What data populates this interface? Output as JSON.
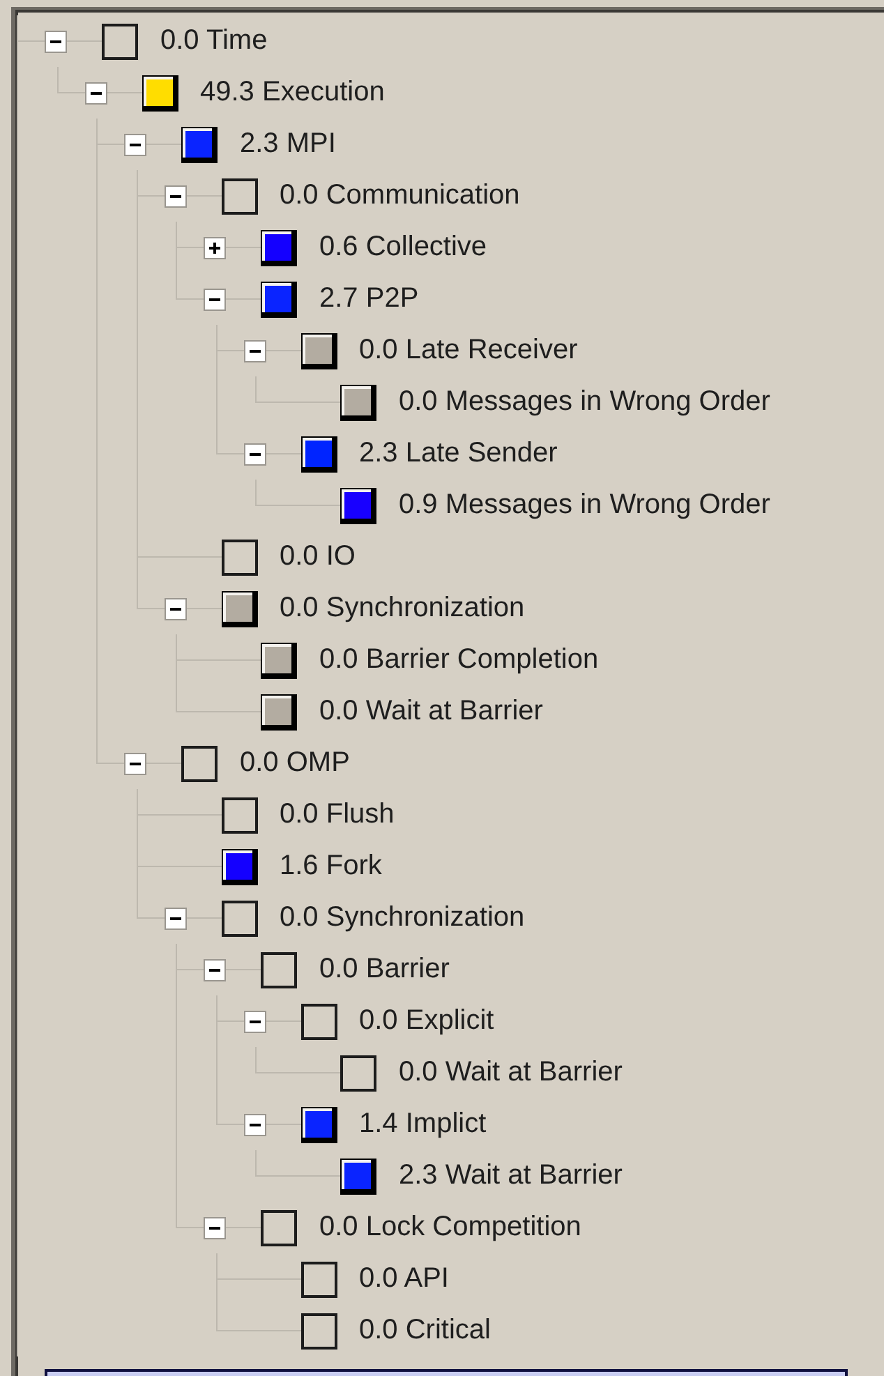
{
  "tree": [
    {
      "label": "0.0 Time",
      "expanded": true,
      "children": [
        {
          "label": "49.3 Execution",
          "color": "#ffdd00",
          "expanded": true,
          "children": [
            {
              "label": "2.3 MPI",
              "color": "#0a24ff",
              "expanded": true,
              "children": [
                {
                  "label": "0.0 Communication",
                  "expanded": true,
                  "children": [
                    {
                      "label": "0.6 Collective",
                      "color": "#1400ff",
                      "expanded": false
                    },
                    {
                      "label": "2.7 P2P",
                      "color": "#0a24ff",
                      "expanded": true,
                      "children": [
                        {
                          "label": "0.0 Late Receiver",
                          "color": "#b3aca1",
                          "expanded": true,
                          "children": [
                            {
                              "label": "0.0 Messages in Wrong Order",
                              "color": "#b3aca1"
                            }
                          ]
                        },
                        {
                          "label": "2.3 Late Sender",
                          "color": "#0024ff",
                          "expanded": true,
                          "children": [
                            {
                              "label": "0.9 Messages in Wrong Order",
                              "color": "#1800ff"
                            }
                          ]
                        }
                      ]
                    }
                  ]
                },
                {
                  "label": "0.0 IO"
                },
                {
                  "label": "0.0 Synchronization",
                  "color": "#b3aca1",
                  "expanded": true,
                  "children": [
                    {
                      "label": "0.0 Barrier Completion",
                      "color": "#b3aca1"
                    },
                    {
                      "label": "0.0 Wait at Barrier",
                      "color": "#b3aca1"
                    }
                  ]
                }
              ]
            },
            {
              "label": "0.0 OMP",
              "expanded": true,
              "children": [
                {
                  "label": "0.0 Flush"
                },
                {
                  "label": "1.6 Fork",
                  "color": "#1400ff"
                },
                {
                  "label": "0.0 Synchronization",
                  "expanded": true,
                  "children": [
                    {
                      "label": "0.0 Barrier",
                      "expanded": true,
                      "children": [
                        {
                          "label": "0.0 Explicit",
                          "expanded": true,
                          "children": [
                            {
                              "label": "0.0 Wait at Barrier"
                            }
                          ]
                        },
                        {
                          "label": "1.4 Implict",
                          "color": "#0a24ff",
                          "expanded": true,
                          "children": [
                            {
                              "label": "2.3 Wait at Barrier",
                              "color": "#0a24ff"
                            }
                          ]
                        }
                      ]
                    },
                    {
                      "label": "0.0 Lock Competition",
                      "expanded": true,
                      "children": [
                        {
                          "label": "0.0 API"
                        },
                        {
                          "label": "0.0 Critical"
                        }
                      ]
                    }
                  ]
                }
              ]
            }
          ]
        }
      ]
    }
  ]
}
